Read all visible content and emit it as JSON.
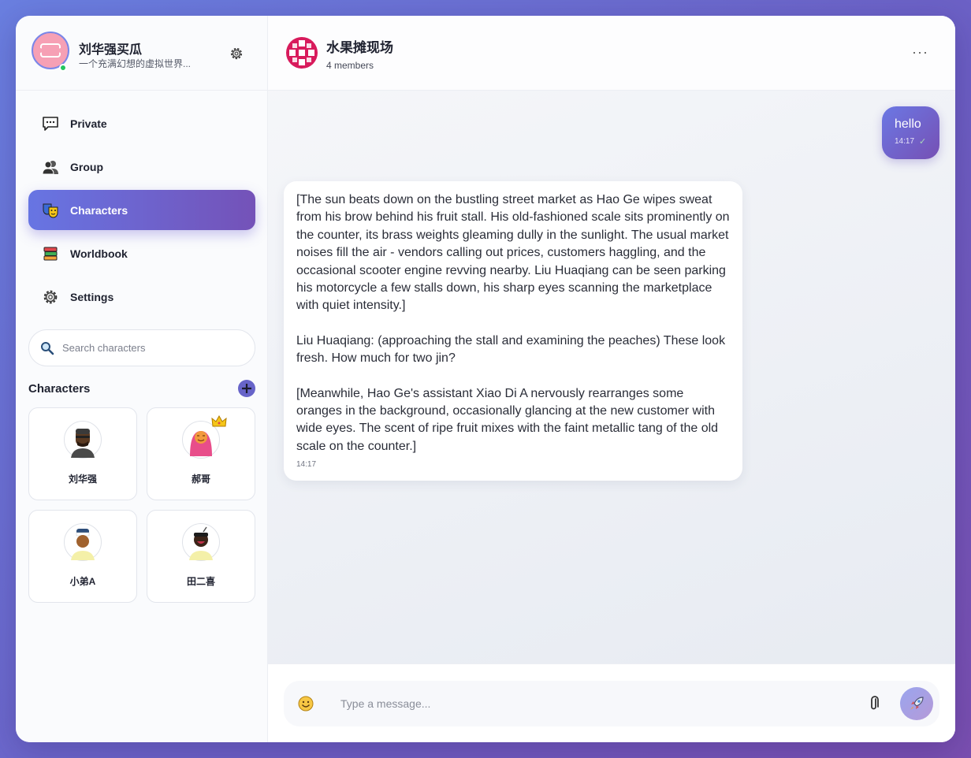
{
  "profile": {
    "name": "刘华强买瓜",
    "status": "一个充满幻想的虚拟世界...",
    "avatar_icon": "ticket-icon"
  },
  "nav": [
    {
      "label": "Private",
      "icon": "speech-bubble-icon"
    },
    {
      "label": "Group",
      "icon": "busts-icon"
    },
    {
      "label": "Characters",
      "icon": "theater-masks-icon",
      "active": true
    },
    {
      "label": "Worldbook",
      "icon": "books-icon"
    },
    {
      "label": "Settings",
      "icon": "gear-icon"
    }
  ],
  "search": {
    "placeholder": "Search characters"
  },
  "characters_section": {
    "title": "Characters"
  },
  "characters": [
    {
      "name": "刘华强"
    },
    {
      "name": "郝哥"
    },
    {
      "name": "小弟A"
    },
    {
      "name": "田二喜"
    }
  ],
  "chat": {
    "group_name": "水果摊现场",
    "members": "4 members",
    "more": "···"
  },
  "messages": [
    {
      "direction": "out",
      "text": "hello",
      "time": "14:17",
      "status": "✓"
    },
    {
      "direction": "in",
      "paragraphs": [
        "[The sun beats down on the bustling street market as Hao Ge wipes sweat from his brow behind his fruit stall. His old-fashioned scale sits prominently on the counter, its brass weights gleaming dully in the sunlight. The usual market noises fill the air - vendors calling out prices, customers haggling, and the occasional scooter engine revving nearby. Liu Huaqiang can be seen parking his motorcycle a few stalls down, his sharp eyes scanning the marketplace with quiet intensity.]",
        "Liu Huaqiang: (approaching the stall and examining the peaches) These look fresh. How much for two jin?",
        "[Meanwhile, Hao Ge's assistant Xiao Di A nervously rearranges some oranges in the background, occasionally glancing at the new customer with wide eyes. The scent of ripe fruit mixes with the faint metallic tang of the old scale on the counter.]"
      ],
      "time": "14:17"
    }
  ],
  "composer": {
    "placeholder": "Type a message..."
  },
  "colors": {
    "accent_start": "#6775e3",
    "accent_end": "#7452b8",
    "online": "#22c55e"
  }
}
